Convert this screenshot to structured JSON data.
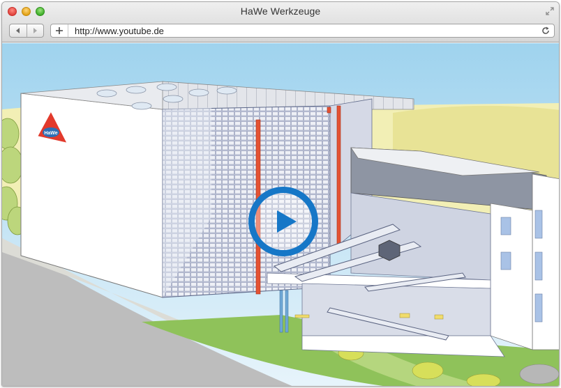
{
  "window": {
    "title": "HaWe Werkzeuge"
  },
  "toolbar": {
    "url": "http://www.youtube.de",
    "back_icon": "back-arrow-icon",
    "forward_icon": "forward-arrow-icon",
    "new_tab_icon": "plus-icon",
    "reload_icon": "reload-icon"
  },
  "video": {
    "logo_text": "HaWe",
    "play_icon": "play-icon",
    "accent_color": "#1677c7",
    "logo_color": "#e23a2c"
  }
}
